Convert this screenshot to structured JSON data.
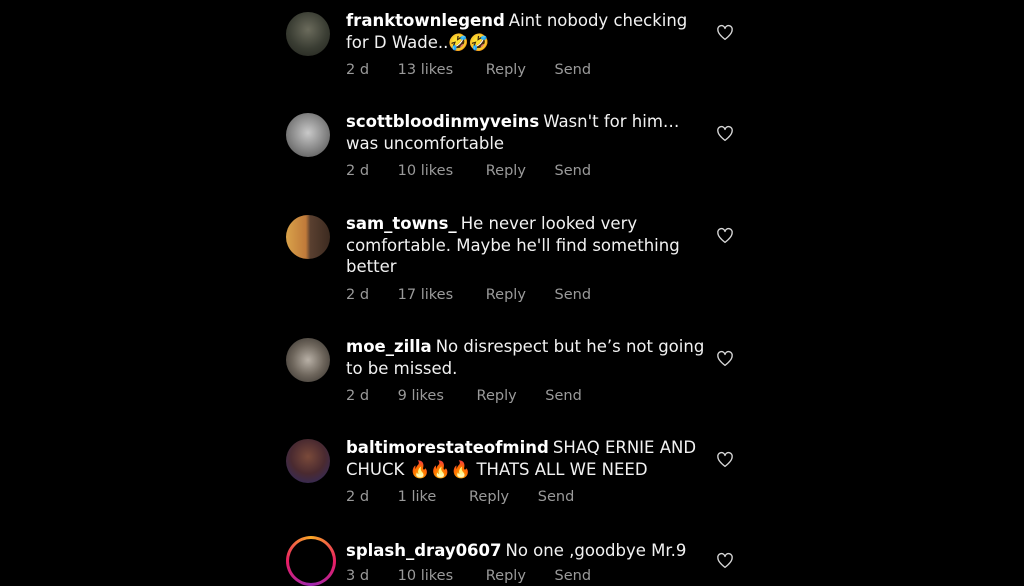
{
  "comments": [
    {
      "username": "franktownlegend",
      "text": "Aint nobody checking for D Wade..🤣🤣",
      "time": "2 d",
      "likes": "13 likes",
      "reply": "Reply",
      "send": "Send"
    },
    {
      "username": "scottbloodinmyveins",
      "text": "Wasn't for him… was uncomfortable",
      "time": "2 d",
      "likes": "10 likes",
      "reply": "Reply",
      "send": "Send"
    },
    {
      "username": "sam_towns_",
      "text": "He never looked very comfortable. Maybe he'll find something better",
      "time": "2 d",
      "likes": "17 likes",
      "reply": "Reply",
      "send": "Send"
    },
    {
      "username": "moe_zilla",
      "text": "No disrespect but he’s not going to be missed.",
      "time": "2 d",
      "likes": "9 likes",
      "reply": "Reply",
      "send": "Send"
    },
    {
      "username": "baltimorestateofmind",
      "text": "SHAQ ERNIE AND CHUCK 🔥🔥🔥 THATS ALL WE NEED",
      "time": "2 d",
      "likes": "1 like",
      "reply": "Reply",
      "send": "Send"
    },
    {
      "username": "splash_dray0607",
      "text": "No one ,goodbye Mr.9",
      "time": "3 d",
      "likes": "10 likes",
      "reply": "Reply",
      "send": "Send"
    }
  ]
}
